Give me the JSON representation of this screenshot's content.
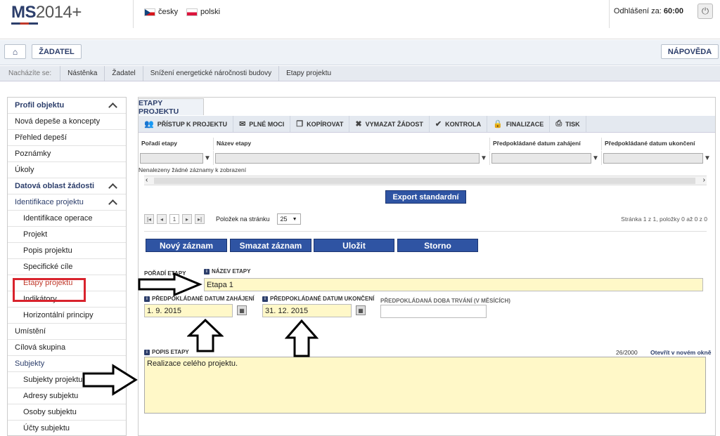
{
  "header": {
    "logo_text": "MS",
    "logo_year": "2014+",
    "languages": [
      {
        "label": "česky",
        "flag": "cz"
      },
      {
        "label": "polski",
        "flag": "pl"
      }
    ],
    "logout_label": "Odhlášení za:",
    "logout_time": "60:00",
    "power_icon": "power-icon"
  },
  "nav": {
    "home_icon": "home-icon",
    "user_button": "ŽADATEL",
    "help_button": "NÁPOVĚDA"
  },
  "breadcrumb": {
    "label": "Nacházíte se:",
    "items": [
      "Nástěnka",
      "Žadatel",
      "Snížení energetické náročnosti budovy",
      "Etapy projektu"
    ]
  },
  "sidebar": {
    "items": [
      {
        "label": "Profil objektu",
        "type": "section",
        "chevron": true
      },
      {
        "label": "Nová depeše a koncepty",
        "type": "item"
      },
      {
        "label": "Přehled depeší",
        "type": "item"
      },
      {
        "label": "Poznámky",
        "type": "item"
      },
      {
        "label": "Úkoly",
        "type": "item"
      },
      {
        "label": "Datová oblast žádosti",
        "type": "section",
        "chevron": true
      },
      {
        "label": "Identifikace projektu",
        "type": "section-light",
        "chevron": true
      },
      {
        "label": "Identifikace operace",
        "type": "sub"
      },
      {
        "label": "Projekt",
        "type": "sub"
      },
      {
        "label": "Popis projektu",
        "type": "sub"
      },
      {
        "label": "Specifické cíle",
        "type": "sub"
      },
      {
        "label": "Etapy projektu",
        "type": "sub-active"
      },
      {
        "label": "Indikátory",
        "type": "sub"
      },
      {
        "label": "Horizontální principy",
        "type": "sub"
      },
      {
        "label": "Umístění",
        "type": "item"
      },
      {
        "label": "Cílová skupina",
        "type": "item"
      },
      {
        "label": "Subjekty",
        "type": "section-light"
      },
      {
        "label": "Subjekty projektu",
        "type": "sub"
      },
      {
        "label": "Adresy subjektu",
        "type": "sub"
      },
      {
        "label": "Osoby subjektu",
        "type": "sub"
      },
      {
        "label": "Účty subjektu",
        "type": "sub"
      }
    ]
  },
  "main": {
    "tab_label": "ETAPY PROJEKTU",
    "toolbar": [
      {
        "label": "PŘÍSTUP K PROJEKTU",
        "icon": "people-icon",
        "glyph": "👥"
      },
      {
        "label": "PLNÉ MOCI",
        "icon": "envelope-icon",
        "glyph": "✉"
      },
      {
        "label": "KOPÍROVAT",
        "icon": "copy-icon",
        "glyph": "❐"
      },
      {
        "label": "VYMAZAT ŽÁDOST",
        "icon": "delete-icon",
        "glyph": "✖"
      },
      {
        "label": "KONTROLA",
        "icon": "check-icon",
        "glyph": "✔"
      },
      {
        "label": "FINALIZACE",
        "icon": "lock-icon",
        "glyph": "🔒"
      },
      {
        "label": "TISK",
        "icon": "print-icon",
        "glyph": "⎙"
      }
    ],
    "grid": {
      "columns": [
        "Pořadí etapy",
        "Název etapy",
        "Předpokládané datum zahájení",
        "Předpokládané datum ukončení"
      ],
      "empty_text": "Nenalezeny žádné záznamy k zobrazení"
    },
    "export_button": "Export standardní",
    "pager": {
      "page": "1",
      "per_page_label": "Položek na stránku",
      "per_page_value": "25",
      "info": "Stránka 1 z 1, položky 0 až 0 z 0"
    },
    "actions": [
      "Nový záznam",
      "Smazat záznam",
      "Uložit",
      "Storno"
    ],
    "form": {
      "poradi_label": "POŘADÍ ETAPY",
      "nazev_label": "NÁZEV ETAPY",
      "nazev_value": "Etapa 1",
      "start_label": "PŘEDPOKLÁDANÉ DATUM ZAHÁJENÍ",
      "start_value": "1. 9. 2015",
      "end_label": "PŘEDPOKLÁDANÉ DATUM UKONČENÍ",
      "end_value": "31. 12. 2015",
      "duration_label": "PŘEDPOKLÁDANÁ DOBA TRVÁNÍ (V MĚSÍCÍCH)",
      "duration_value": "",
      "popis_label": "POPIS ETAPY",
      "popis_counter": "26/2000",
      "popis_link": "Otevřít v novém okně",
      "popis_value": "Realizace celého projektu."
    }
  }
}
